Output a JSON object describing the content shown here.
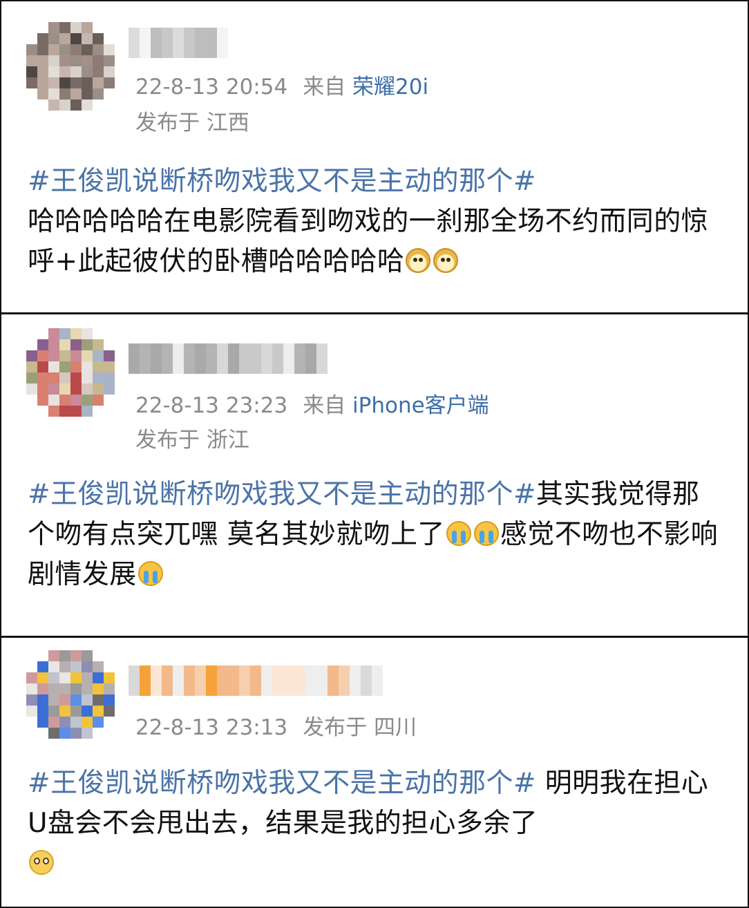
{
  "posts": [
    {
      "timestamp": "22-8-13 20:54",
      "source_label": "来自",
      "device": "荣耀20i",
      "location_label": "发布于",
      "location": "江西",
      "topic": "#王俊凯说断桥吻戏我又不是主动的那个#",
      "body_line1": "哈哈哈哈哈在电影院看到吻戏的一刹那全场不约而同的惊呼+此起彼伏的卧槽哈哈哈哈哈",
      "emojis": [
        "doge-emoji",
        "doge-emoji"
      ]
    },
    {
      "timestamp": "22-8-13 23:23",
      "source_label": "来自",
      "device": "iPhone客户端",
      "location_label": "发布于",
      "location": "浙江",
      "topic": "#王俊凯说断桥吻戏我又不是主动的那个#",
      "body_part1": "其实我觉得那个吻有点突兀嘿 莫名其妙就吻上了",
      "body_part2": "感觉不吻也不影响剧情发展",
      "emojis": [
        "crying-emoji",
        "crying-emoji",
        "crying-emoji"
      ]
    },
    {
      "timestamp": "22-8-13 23:13",
      "location_label": "发布于",
      "location": "四川",
      "topic": "#王俊凯说断桥吻戏我又不是主动的那个#",
      "body_line1": " 明明我在担心U盘会不会甩出去，结果是我的担心多余了",
      "emojis": [
        "pleading-emoji"
      ]
    }
  ],
  "colors": {
    "topic": "#4a73a8",
    "device": "#3d6ea6",
    "meta": "#8a8a8a",
    "text": "#111111",
    "border": "#111111"
  }
}
